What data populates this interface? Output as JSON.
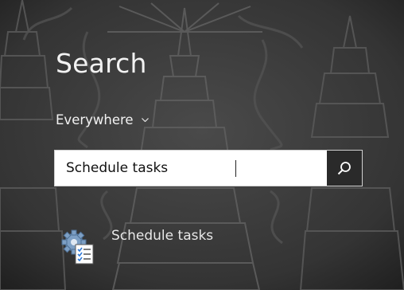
{
  "search": {
    "title": "Search",
    "scope_label": "Everywhere",
    "query": "Schedule tasks",
    "button_icon": "magnifier-icon"
  },
  "results": [
    {
      "label": "Schedule tasks",
      "icon": "task-scheduler-icon"
    }
  ],
  "colors": {
    "panel_text": "#f2f2f2",
    "search_button_bg": "#2a2a2a",
    "search_box_bg": "#ffffff"
  }
}
